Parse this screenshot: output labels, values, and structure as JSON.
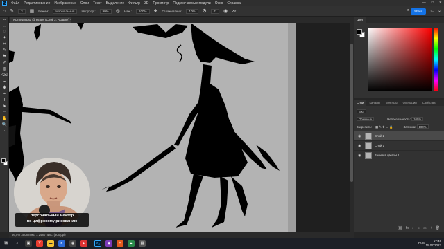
{
  "app": {
    "logo": "Ps",
    "menu": [
      "Файл",
      "Редактирование",
      "Изображение",
      "Слои",
      "Текст",
      "Выделение",
      "Фильтр",
      "3D",
      "Просмотр",
      "Подключаемые модули",
      "Окно",
      "Справка"
    ],
    "window_controls": [
      "—",
      "□",
      "✕"
    ]
  },
  "options_bar": {
    "brush_size": "3",
    "mode_label": "Режим:",
    "mode_value": "Нормальный",
    "opacity_label": "Непрозр.:",
    "opacity_value": "90%",
    "flow_label": "Наж.:",
    "flow_value": "100%",
    "smoothing_label": "Сглаживание:",
    "smoothing_value": "10%",
    "angle_value": "0°",
    "share_label": "Share"
  },
  "document": {
    "tab_title": "NDmyum.psd @ 66,5% (Слой 2, RGB/8#) *"
  },
  "toolbar": {
    "tools": [
      "↔",
      "⬚",
      "◌",
      "✦",
      "⌗",
      "✎",
      "⚑",
      "✐",
      "◍",
      "⌫",
      "◒",
      "⧫",
      "✒",
      "T",
      "➤",
      "▭",
      "✋",
      "🔍",
      "⋯"
    ]
  },
  "webcam": {
    "caption_line1": "персональный ментор",
    "caption_line2": "по цифровому рисованию"
  },
  "color_panel": {
    "tabs": [
      "Цвет"
    ],
    "hue_color": "#ff0000"
  },
  "layers_panel": {
    "tabs": [
      "Слои",
      "Каналы",
      "Контуры",
      "Операции",
      "Свойства"
    ],
    "search_label": "Вид",
    "blend_mode": "Обычные",
    "opacity_label": "Непрозрачность:",
    "opacity_value": "100%",
    "lock_label": "Закрепить:",
    "fill_label": "Заливка:",
    "fill_value": "100%",
    "layers": [
      {
        "name": "Слой 2",
        "selected": true
      },
      {
        "name": "Слой 1",
        "selected": false
      },
      {
        "name": "Заливка цветом 1",
        "selected": false
      }
    ],
    "footer_icons": [
      "⛓",
      "fx",
      "◐",
      "◑",
      "▭",
      "+",
      "🗑"
    ]
  },
  "status_bar": {
    "text": "66,5%    3508 пикс. x 2480 пикс. (300 ppi)"
  },
  "taskbar": {
    "lang": "РУС",
    "time": "17:40",
    "date": "15.07.2023"
  }
}
